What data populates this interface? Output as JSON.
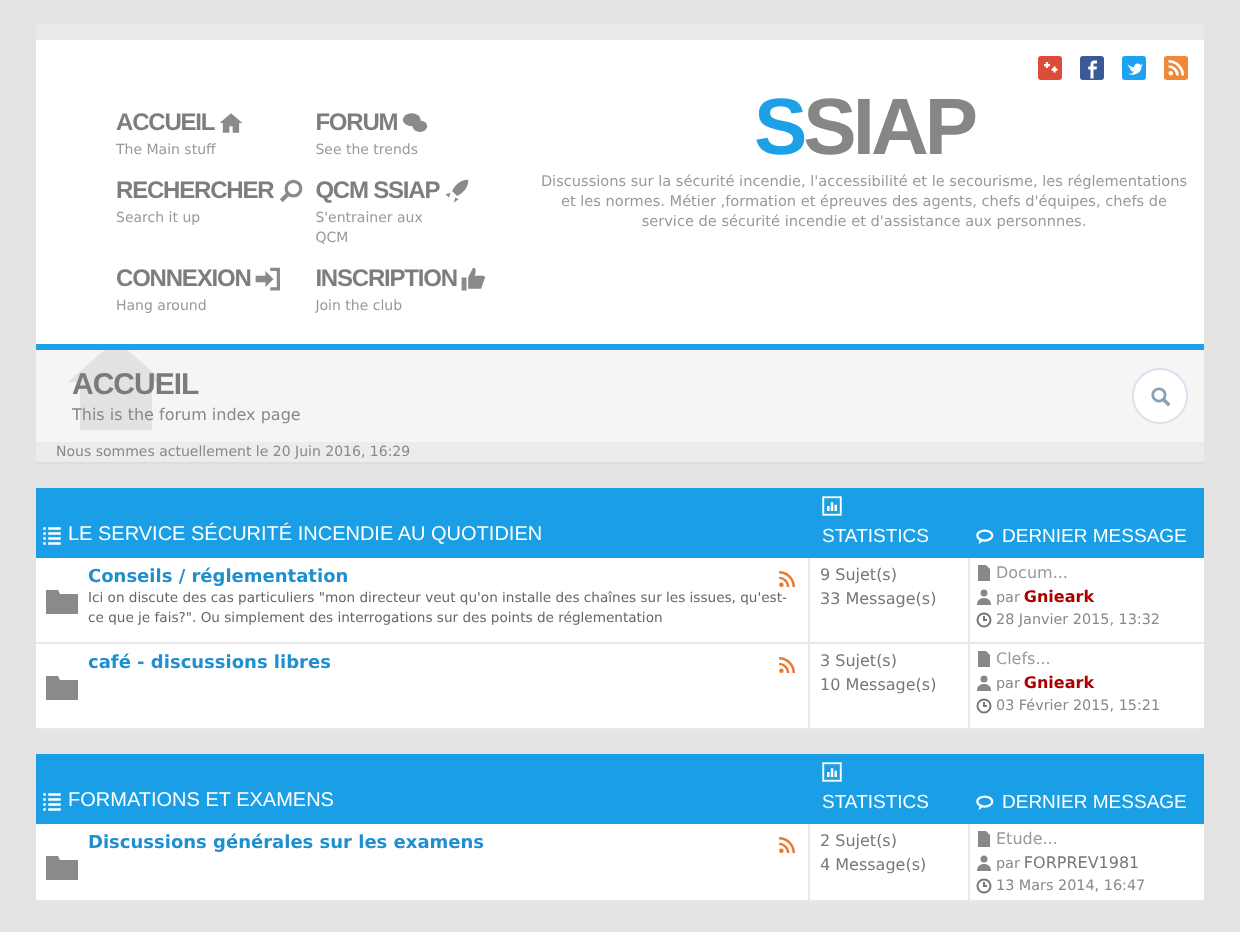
{
  "header": {
    "nav": [
      {
        "title": "ACCUEIL",
        "subtitle": "The Main stuff"
      },
      {
        "title": "FORUM",
        "subtitle": "See the trends"
      },
      {
        "title": "RECHERCHER",
        "subtitle": "Search it up"
      },
      {
        "title": "QCM SSIAP",
        "subtitle": "S'entrainer aux QCM"
      },
      {
        "title": "CONNEXION",
        "subtitle": "Hang around"
      },
      {
        "title": "INSCRIPTION",
        "subtitle": "Join the club"
      }
    ],
    "logo": {
      "accent": "S",
      "rest": "SIAP"
    },
    "description": "Discussions sur la sécurité incendie, l'accessibilité et le secourisme, les réglementations et les normes. Métier ,formation et épreuves des agents, chefs d'équipes, chefs de service de sécurité incendie et d'assistance aux personnnes."
  },
  "page_header": {
    "title": "ACCUEIL",
    "subtitle": "This is the forum index page",
    "date": "Nous sommes actuellement le 20 Juin 2016, 16:29"
  },
  "categories": [
    {
      "title": "LE SERVICE SÉCURITÉ INCENDIE AU QUOTIDIEN",
      "stats_heading": "STATISTICS",
      "last_heading": "DERNIER MESSAGE",
      "forums": [
        {
          "name": "Conseils / réglementation",
          "description": "Ici on discute des cas particuliers \"mon directeur veut qu'on installe des chaînes sur les issues, qu'est-ce que je fais?\". Ou simplement des interrogations sur des points de réglementation",
          "topics": "9 Sujet(s)",
          "posts": "33 Message(s)",
          "last_title": "Docum...",
          "by": "par",
          "author": {
            "name": "Gnieark",
            "color": "#aa0000"
          },
          "date": "28 Janvier 2015, 13:32"
        },
        {
          "name": "café - discussions libres",
          "topics": "3 Sujet(s)",
          "posts": "10 Message(s)",
          "last_title": "Clefs...",
          "by": "par",
          "author": {
            "name": "Gnieark",
            "color": "#aa0000"
          },
          "date": "03 Février 2015, 15:21"
        }
      ]
    },
    {
      "title": "FORMATIONS ET EXAMENS",
      "stats_heading": "STATISTICS",
      "last_heading": "DERNIER MESSAGE",
      "forums": [
        {
          "name": "Discussions générales sur les examens",
          "topics": "2 Sujet(s)",
          "posts": "4 Message(s)",
          "last_title": "Etude...",
          "by": "par",
          "author": {
            "name": "FORPREV1981",
            "color": "#777777"
          },
          "date": "13 Mars 2014, 16:47"
        }
      ]
    }
  ]
}
